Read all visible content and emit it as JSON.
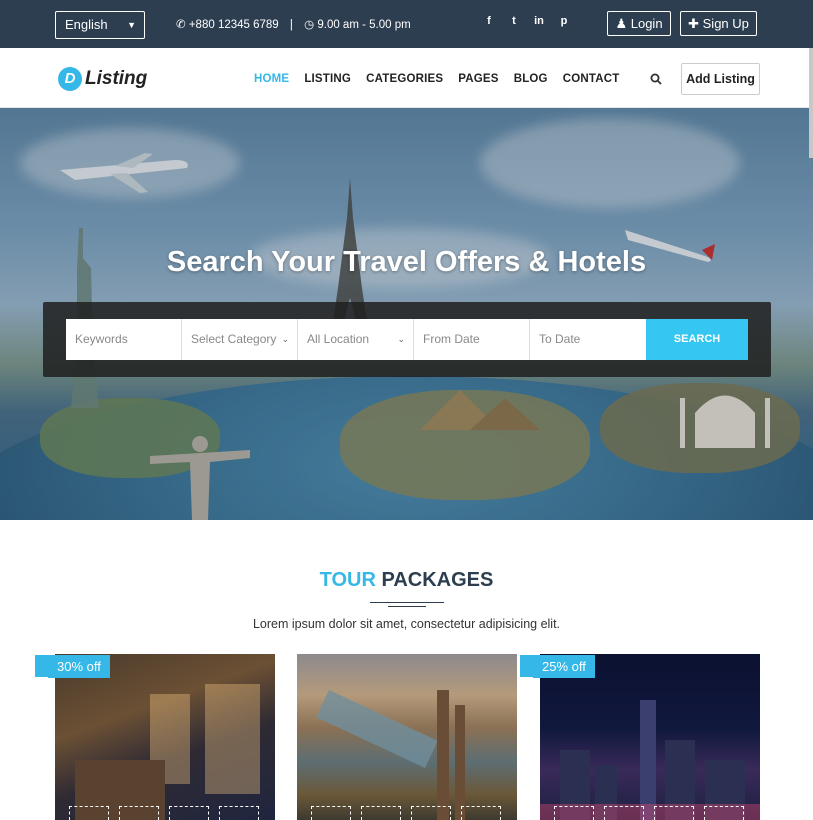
{
  "topbar": {
    "language": "English",
    "phone": "+880 12345 6789",
    "separator": "|",
    "hours": "9.00 am - 5.00 pm",
    "social": [
      {
        "icon": "facebook-icon",
        "glyph": "f"
      },
      {
        "icon": "twitter-icon",
        "glyph": "t"
      },
      {
        "icon": "linkedin-icon",
        "glyph": "in"
      },
      {
        "icon": "pinterest-icon",
        "glyph": "p"
      }
    ],
    "login_label": "Login",
    "signup_label": "Sign Up"
  },
  "nav": {
    "logo_letter": "D",
    "logo_text": "Listing",
    "menu": [
      {
        "label": "HOME",
        "active": true
      },
      {
        "label": "LISTING",
        "active": false
      },
      {
        "label": "CATEGORIES",
        "active": false
      },
      {
        "label": "PAGES",
        "active": false
      },
      {
        "label": "BLOG",
        "active": false
      },
      {
        "label": "CONTACT",
        "active": false
      }
    ],
    "add_listing_label": "Add Listing"
  },
  "hero": {
    "title": "Search Your Travel Offers & Hotels",
    "fields": {
      "keywords": "Keywords",
      "category": "Select Category",
      "location": "All Location",
      "from_date": "From Date",
      "to_date": "To Date"
    },
    "search_label": "SEARCH"
  },
  "section": {
    "title_accent": "TOUR",
    "title_rest": "PACKAGES",
    "subtitle": "Lorem ipsum dolor sit amet, consectetur adipisicing elit.",
    "cards": [
      {
        "badge": "30% off"
      },
      {
        "badge": ""
      },
      {
        "badge": "25% off"
      }
    ]
  },
  "colors": {
    "accent": "#35b8e8",
    "topbar": "#2d3e50",
    "search_button": "#35c6f1"
  }
}
